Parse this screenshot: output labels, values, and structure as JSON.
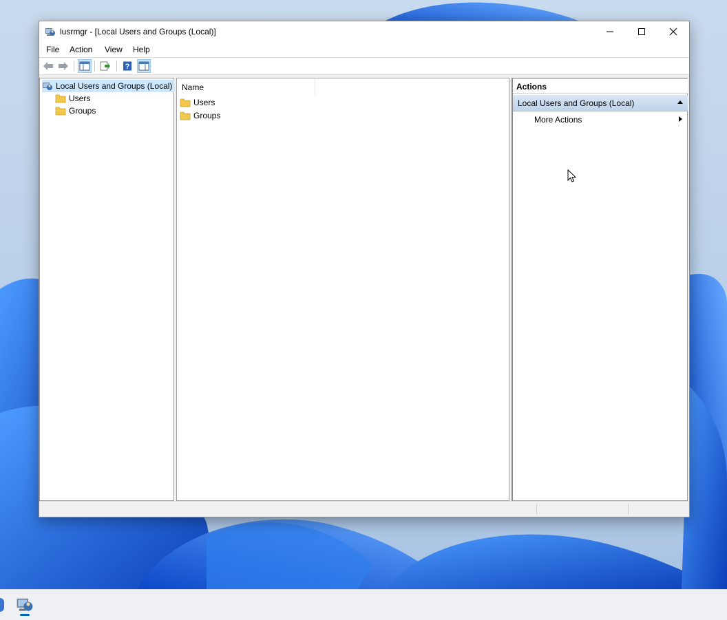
{
  "window": {
    "title": "lusrmgr - [Local Users and Groups (Local)]",
    "controls": [
      "minimize",
      "maximize",
      "close"
    ]
  },
  "menu": {
    "file": "File",
    "action": "Action",
    "view": "View",
    "help": "Help"
  },
  "toolbar": {
    "icons": [
      "back-arrow-icon",
      "forward-arrow-icon",
      "show-hide-console-tree-icon",
      "export-list-icon",
      "help-icon",
      "show-hide-action-pane-icon"
    ]
  },
  "tree": {
    "root": "Local Users and Groups (Local)",
    "items": [
      "Users",
      "Groups"
    ]
  },
  "list": {
    "column_name": "Name",
    "items": [
      "Users",
      "Groups"
    ]
  },
  "actions": {
    "title": "Actions",
    "section": "Local Users and Groups (Local)",
    "more_actions": "More Actions"
  },
  "colors": {
    "selection": "#cce8ff",
    "section_header": "#bfd3ea",
    "folder": "#f2c94c",
    "wallpaper_blue": "#1a5fd0"
  }
}
